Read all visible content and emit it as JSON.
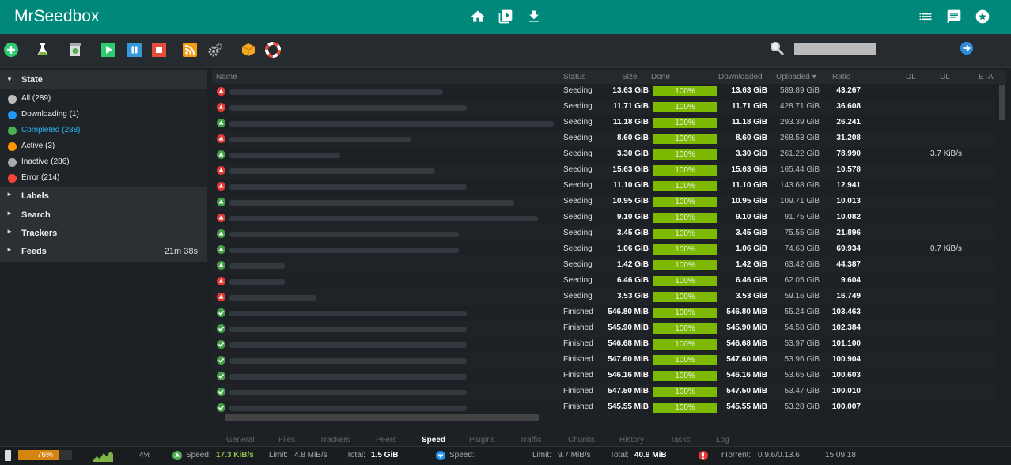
{
  "app": {
    "title": "MrSeedbox"
  },
  "header_icons": [
    "home-icon",
    "video-library-icon",
    "download-icon",
    "list-icon",
    "chat-icon",
    "star-badge-icon"
  ],
  "toolbar": {
    "tools": [
      "add-torrent-icon",
      "create-torrent-icon",
      "remove-icon",
      "start-icon",
      "pause-icon",
      "stop-icon",
      "rss-icon",
      "settings-icon",
      "plugins-icon",
      "help-icon"
    ],
    "search_placeholder": ""
  },
  "sidebar": {
    "state_header": "State",
    "states": [
      {
        "label": "All (289)",
        "color": "#bbbbbb"
      },
      {
        "label": "Downloading (1)",
        "color": "#2196f3"
      },
      {
        "label": "Completed (288)",
        "color": "#4caf50"
      },
      {
        "label": "Active (3)",
        "color": "#ff9800"
      },
      {
        "label": "Inactive (286)",
        "color": "#aaaaaa"
      },
      {
        "label": "Error (214)",
        "color": "#f44336"
      }
    ],
    "labels_header": "Labels",
    "search_header": "Search",
    "trackers_header": "Trackers",
    "feeds_header": "Feeds",
    "feeds_time": "21m 38s"
  },
  "table": {
    "columns": {
      "name": "Name",
      "status": "Status",
      "size": "Size",
      "done": "Done",
      "downloaded": "Downloaded",
      "uploaded": "Uploaded ▾",
      "ratio": "Ratio",
      "dl": "DL",
      "ul": "UL",
      "eta": "ETA"
    },
    "rows": [
      {
        "state": "error",
        "status": "Seeding",
        "size": "13.63 GiB",
        "done": "100%",
        "downloaded": "13.63 GiB",
        "uploaded": "589.89 GiB",
        "ratio": "43.267",
        "ul": ""
      },
      {
        "state": "error",
        "status": "Seeding",
        "size": "11.71 GiB",
        "done": "100%",
        "downloaded": "11.71 GiB",
        "uploaded": "428.71 GiB",
        "ratio": "36.608",
        "ul": ""
      },
      {
        "state": "seed",
        "status": "Seeding",
        "size": "11.18 GiB",
        "done": "100%",
        "downloaded": "11.18 GiB",
        "uploaded": "293.39 GiB",
        "ratio": "26.241",
        "ul": ""
      },
      {
        "state": "error",
        "status": "Seeding",
        "size": "8.60 GiB",
        "done": "100%",
        "downloaded": "8.60 GiB",
        "uploaded": "268.53 GiB",
        "ratio": "31.208",
        "ul": ""
      },
      {
        "state": "seed",
        "status": "Seeding",
        "size": "3.30 GiB",
        "done": "100%",
        "downloaded": "3.30 GiB",
        "uploaded": "261.22 GiB",
        "ratio": "78.990",
        "ul": "3.7 KiB/s"
      },
      {
        "state": "error",
        "status": "Seeding",
        "size": "15.63 GiB",
        "done": "100%",
        "downloaded": "15.63 GiB",
        "uploaded": "165.44 GiB",
        "ratio": "10.578",
        "ul": ""
      },
      {
        "state": "error",
        "status": "Seeding",
        "size": "11.10 GiB",
        "done": "100%",
        "downloaded": "11.10 GiB",
        "uploaded": "143.68 GiB",
        "ratio": "12.941",
        "ul": ""
      },
      {
        "state": "seed",
        "status": "Seeding",
        "size": "10.95 GiB",
        "done": "100%",
        "downloaded": "10.95 GiB",
        "uploaded": "109.71 GiB",
        "ratio": "10.013",
        "ul": ""
      },
      {
        "state": "error",
        "status": "Seeding",
        "size": "9.10 GiB",
        "done": "100%",
        "downloaded": "9.10 GiB",
        "uploaded": "91.75 GiB",
        "ratio": "10.082",
        "ul": ""
      },
      {
        "state": "seed",
        "status": "Seeding",
        "size": "3.45 GiB",
        "done": "100%",
        "downloaded": "3.45 GiB",
        "uploaded": "75.55 GiB",
        "ratio": "21.896",
        "ul": ""
      },
      {
        "state": "seed",
        "status": "Seeding",
        "size": "1.06 GiB",
        "done": "100%",
        "downloaded": "1.06 GiB",
        "uploaded": "74.63 GiB",
        "ratio": "69.934",
        "ul": "0.7 KiB/s"
      },
      {
        "state": "seed",
        "status": "Seeding",
        "size": "1.42 GiB",
        "done": "100%",
        "downloaded": "1.42 GiB",
        "uploaded": "63.42 GiB",
        "ratio": "44.387",
        "ul": ""
      },
      {
        "state": "error",
        "status": "Seeding",
        "size": "6.46 GiB",
        "done": "100%",
        "downloaded": "6.46 GiB",
        "uploaded": "62.05 GiB",
        "ratio": "9.604",
        "ul": ""
      },
      {
        "state": "error",
        "status": "Seeding",
        "size": "3.53 GiB",
        "done": "100%",
        "downloaded": "3.53 GiB",
        "uploaded": "59.16 GiB",
        "ratio": "16.749",
        "ul": ""
      },
      {
        "state": "done",
        "status": "Finished",
        "size": "546.80 MiB",
        "done": "100%",
        "downloaded": "546.80 MiB",
        "uploaded": "55.24 GiB",
        "ratio": "103.463",
        "ul": ""
      },
      {
        "state": "done",
        "status": "Finished",
        "size": "545.90 MiB",
        "done": "100%",
        "downloaded": "545.90 MiB",
        "uploaded": "54.58 GiB",
        "ratio": "102.384",
        "ul": ""
      },
      {
        "state": "done",
        "status": "Finished",
        "size": "546.68 MiB",
        "done": "100%",
        "downloaded": "546.68 MiB",
        "uploaded": "53.97 GiB",
        "ratio": "101.100",
        "ul": ""
      },
      {
        "state": "done",
        "status": "Finished",
        "size": "547.60 MiB",
        "done": "100%",
        "downloaded": "547.60 MiB",
        "uploaded": "53.96 GiB",
        "ratio": "100.904",
        "ul": ""
      },
      {
        "state": "done",
        "status": "Finished",
        "size": "546.16 MiB",
        "done": "100%",
        "downloaded": "546.16 MiB",
        "uploaded": "53.65 GiB",
        "ratio": "100.603",
        "ul": ""
      },
      {
        "state": "done",
        "status": "Finished",
        "size": "547.50 MiB",
        "done": "100%",
        "downloaded": "547.50 MiB",
        "uploaded": "53.47 GiB",
        "ratio": "100.010",
        "ul": ""
      },
      {
        "state": "done",
        "status": "Finished",
        "size": "545.55 MiB",
        "done": "100%",
        "downloaded": "545.55 MiB",
        "uploaded": "53.28 GiB",
        "ratio": "100.007",
        "ul": ""
      }
    ]
  },
  "tabs": [
    "General",
    "Files",
    "Trackers",
    "Peers",
    "Speed",
    "Plugins",
    "Traffic",
    "Chunks",
    "History",
    "Tasks",
    "Log"
  ],
  "active_tab": "Speed",
  "statusbar": {
    "disk_usage": "76%",
    "disk_fraction": 0.76,
    "cpu": "4%",
    "ul_speed_label": "Speed:",
    "ul_speed": "17.3 KiB/s",
    "ul_limit_label": "Limit:",
    "ul_limit": "4.8 MiB/s",
    "ul_total_label": "Total:",
    "ul_total": "1.5 GiB",
    "dl_speed_label": "Speed:",
    "dl_limit_label": "Limit:",
    "dl_limit": "9.7 MiB/s",
    "dl_total_label": "Total:",
    "dl_total": "40.9 MiB",
    "client_label": "rTorrent:",
    "client_version": "0.9.6/0.13.6",
    "clock": "15:09:18"
  }
}
